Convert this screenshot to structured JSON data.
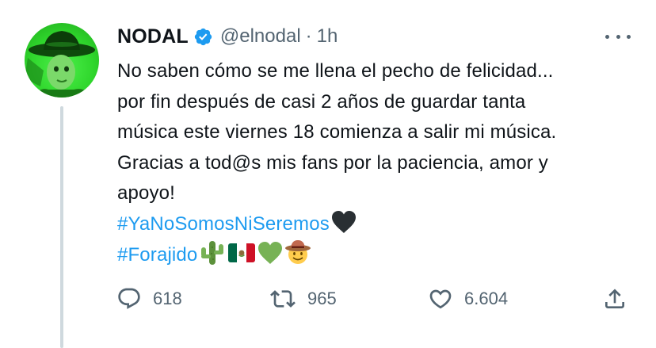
{
  "tweet": {
    "display_name": "NODAL",
    "handle": "@elnodal",
    "separator": "·",
    "time": "1h",
    "text_lines": [
      "No saben cómo se me llena el pecho de felicidad...",
      "por fin después de casi 2 años de guardar tanta",
      "música este viernes 18 comienza a salir mi música.",
      "Gracias a tod@s mis fans por la paciencia, amor y",
      "apoyo!"
    ],
    "hashtags": [
      "#YaNoSomosNiSeremos",
      "#Forajido"
    ],
    "emoji_icons": {
      "line1": [
        "black-heart-icon"
      ],
      "line2": [
        "cactus-icon",
        "mexico-flag-icon",
        "green-heart-icon",
        "cowboy-face-icon"
      ]
    }
  },
  "actions": {
    "replies": "618",
    "retweets": "965",
    "likes": "6.604"
  },
  "colors": {
    "hashtag": "#1d9bf0",
    "verified": "#1d9bf0",
    "secondary_text": "#536471",
    "thread_line": "#cfd9de"
  }
}
